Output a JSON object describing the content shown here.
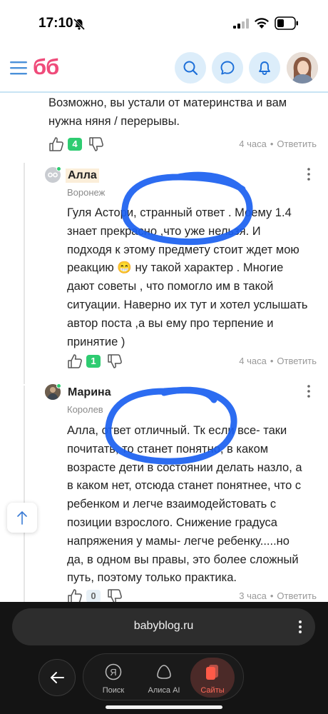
{
  "status": {
    "time": "17:10"
  },
  "header": {
    "logo": "бб"
  },
  "comments": [
    {
      "lines": [
        "Возможно, вы устали от материнства и вам",
        "нужна няня / перерывы."
      ],
      "likes": "4",
      "time": "4 часа",
      "reply": "Ответить"
    },
    {
      "author": "Алла",
      "city": "Воронеж",
      "lines": [
        "Гуля Астори, странный ответ . Моему 1.4",
        "знает прекрасно ,что уже нельзя. И",
        "подходя к этому предмету стоит ждет мою",
        "реакцию 😁 ну такой характер . Многие",
        "дают советы , что помогло им в такой",
        "ситуации. Наверно их тут и хотел услышать",
        "автор поста ,а вы ему про терпение и",
        "принятие )"
      ],
      "likes": "1",
      "time": "4 часа",
      "reply": "Ответить"
    },
    {
      "author": "Марина",
      "city": "Королев",
      "lines": [
        "Алла, ответ отличный. Тк если все- таки",
        "почитать, то станет понятно, в каком",
        "возрасте дети в состоянии делать назло, а",
        "в каком нет, отсюда станет понятнее, что с",
        "ребенком и легче взаимодейстовать с",
        "позиции взрослого. Снижение градуса",
        "напряжения у мамы- легче ребенку.....но",
        "да, в одном вы правы, это более сложный",
        "путь, поэтому только практика."
      ],
      "likes": "0",
      "time": "3 часа",
      "reply": "Ответить"
    }
  ],
  "browser": {
    "url": "babyblog.ru",
    "nav": [
      {
        "label": "Поиск",
        "icon": "yandex-search-icon"
      },
      {
        "label": "Алиса AI",
        "icon": "alice-icon"
      },
      {
        "label": "Сайты",
        "icon": "sites-icon"
      }
    ]
  },
  "colors": {
    "brand": "#ef4b7a",
    "accent": "#1d6fd8",
    "header_button_bg": "#dcedfa",
    "like_badge": "#2ecc71",
    "scribble": "#1a5ff0"
  }
}
